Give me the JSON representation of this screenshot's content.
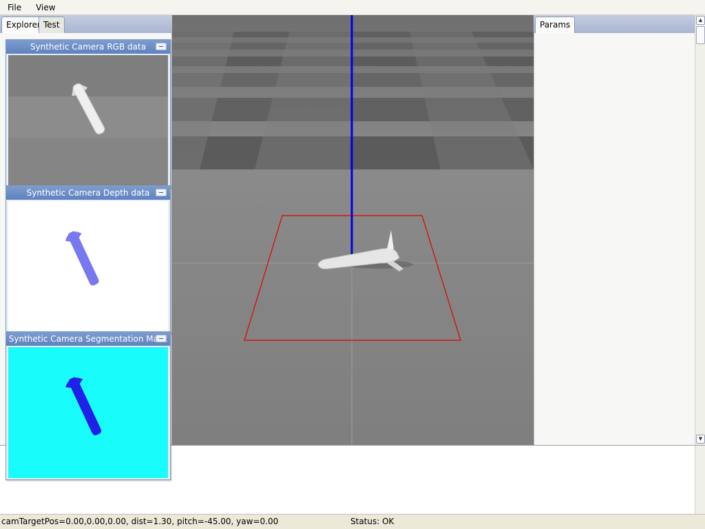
{
  "menu": {
    "file": "File",
    "view": "View"
  },
  "left_tabs": [
    {
      "label": "Explorer"
    },
    {
      "label": "Test"
    }
  ],
  "right_tabs": [
    {
      "label": "Params"
    }
  ],
  "camera_windows": {
    "rgb": {
      "title": "Synthetic Camera RGB data"
    },
    "depth": {
      "title": "Synthetic Camera Depth data"
    },
    "segmentation": {
      "title": "Synthetic Camera Segmentation Mask"
    }
  },
  "status": {
    "camera": "camTargetPos=0.00,0.00,0.00, dist=1.30, pitch=-45.00, yaw=0.00",
    "state": "Status: OK"
  },
  "colors": {
    "axis_z": "#0000dd",
    "selection_box": "#e00000",
    "segmentation_bg": "#18fcfc",
    "segmentation_object": "#2020e8",
    "depth_object": "#7878f0"
  },
  "icons": {
    "scroll_up": "▲",
    "scroll_down": "▼"
  }
}
